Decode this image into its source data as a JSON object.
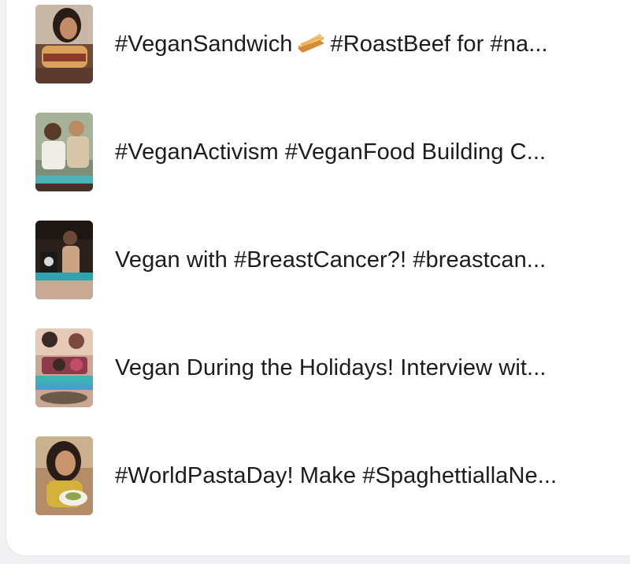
{
  "videos": [
    {
      "title_before_emoji": "#VeganSandwich",
      "emoji": "sandwich-emoji",
      "title_after_emoji": "#RoastBeef for #na...",
      "thumb_bg": "#7a4f3a"
    },
    {
      "title": "#VeganActivism #VeganFood Building C...",
      "thumb_bg": "#8a9a86"
    },
    {
      "title": "Vegan with #BreastCancer?! #breastcan...",
      "thumb_bg": "#3a2a24"
    },
    {
      "title": "Vegan During the Holidays! Interview wit...",
      "thumb_bg": "#9b6f5b"
    },
    {
      "title": "#WorldPastaDay! Make #SpaghettiallaNe...",
      "thumb_bg": "#a6825f"
    }
  ]
}
